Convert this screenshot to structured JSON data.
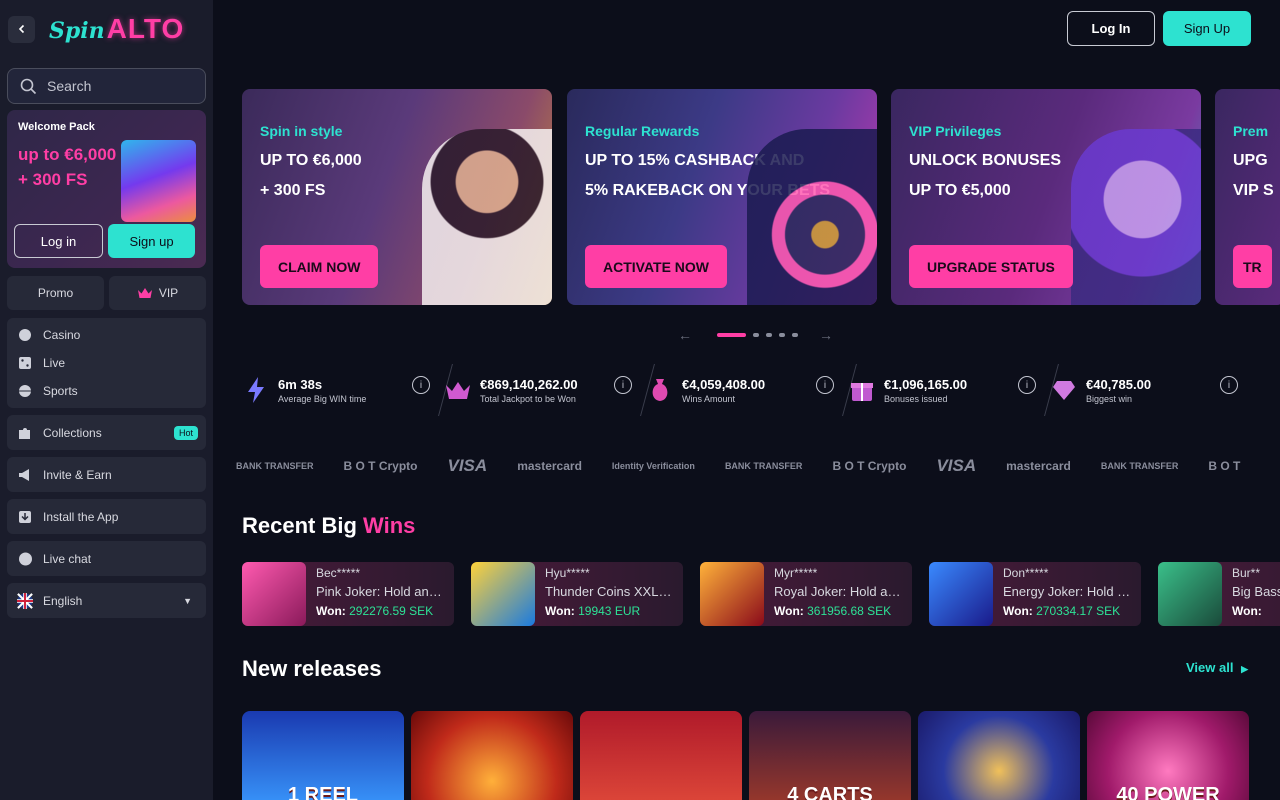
{
  "brand": {
    "logo_script": "Spin",
    "logo_main": "ALTO"
  },
  "sidebar": {
    "search_placeholder": "Search",
    "welcome": {
      "title": "Welcome Pack",
      "line1": "up to €6,000",
      "line2": "+ 300 FS",
      "login": "Log in",
      "signup": "Sign up"
    },
    "promo": "Promo",
    "vip": "VIP",
    "nav": [
      {
        "label": "Casino",
        "icon": "casino-icon"
      },
      {
        "label": "Live",
        "icon": "dice-icon"
      },
      {
        "label": "Sports",
        "icon": "sports-ball-icon"
      }
    ],
    "collections": "Collections",
    "hot_badge": "Hot",
    "invite": "Invite & Earn",
    "install": "Install the App",
    "live_chat": "Live chat",
    "language": "English"
  },
  "header": {
    "login": "Log In",
    "signup": "Sign Up"
  },
  "banners": [
    {
      "tag": "Spin in style",
      "line1": "UP TO €6,000",
      "line2": "+ 300 FS",
      "cta": "CLAIM NOW"
    },
    {
      "tag": "Regular Rewards",
      "line1": "UP TO 15% CASHBACK AND",
      "line2": "5% RAKEBACK ON YOUR BETS",
      "cta": "ACTIVATE NOW"
    },
    {
      "tag": "VIP Privileges",
      "line1": "UNLOCK BONUSES",
      "line2": "UP TO €5,000",
      "cta": "UPGRADE STATUS"
    },
    {
      "tag": "Prem",
      "line1": "UPG",
      "line2": "VIP S",
      "cta": "TR"
    }
  ],
  "carousel": {
    "prev": "←",
    "next": "→",
    "active_index": 0,
    "count": 5
  },
  "stats": [
    {
      "value": "6m 38s",
      "label": "Average Big WIN time",
      "icon": "lightning-icon"
    },
    {
      "value": "€869,140,262.00",
      "label": "Total Jackpot to be Won",
      "icon": "crown-icon"
    },
    {
      "value": "€4,059,408.00",
      "label": "Wins Amount",
      "icon": "money-bag-icon"
    },
    {
      "value": "€1,096,165.00",
      "label": "Bonuses issued",
      "icon": "gift-icon"
    },
    {
      "value": "€40,785.00",
      "label": "Biggest win",
      "icon": "diamond-icon"
    }
  ],
  "payments": [
    "BANK TRANSFER",
    "B O T Crypto",
    "VISA",
    "mastercard",
    "Identity Verification",
    "BANK TRANSFER",
    "B O T Crypto",
    "VISA",
    "mastercard",
    "BANK TRANSFER",
    "B O T"
  ],
  "recent_wins": {
    "title_a": "Recent Big ",
    "title_b": "Wins",
    "won_label": "Won:",
    "items": [
      {
        "user": "Bec*****",
        "game": "Pink Joker: Hold and Win",
        "amount": "292276.59 SEK",
        "color": "#d23a8a"
      },
      {
        "user": "Hyu*****",
        "game": "Thunder Coins XXL: Hold and Win",
        "amount": "19943 EUR",
        "color": "#2a9ae0"
      },
      {
        "user": "Myr*****",
        "game": "Royal Joker: Hold and Win",
        "amount": "361956.68 SEK",
        "color": "#b01a2a"
      },
      {
        "user": "Don*****",
        "game": "Energy Joker: Hold and Win",
        "amount": "270334.17 SEK",
        "color": "#2a4ad0"
      },
      {
        "user": "Bur**",
        "game": "Big Bass Splash",
        "amount": "",
        "color": "#2a7a4a"
      }
    ]
  },
  "new_releases": {
    "title": "New releases",
    "view_all": "View all",
    "games": [
      {
        "title": "1 REEL",
        "color": "#1a5ad0"
      },
      {
        "title": "",
        "color": "#d04a1a"
      },
      {
        "title": "",
        "color": "#c0243a"
      },
      {
        "title": "4 CARTS",
        "color": "#7a2a2a"
      },
      {
        "title": "",
        "color": "#2a3aa0"
      },
      {
        "title": "40 POWER",
        "color": "#b02a7a"
      }
    ]
  }
}
